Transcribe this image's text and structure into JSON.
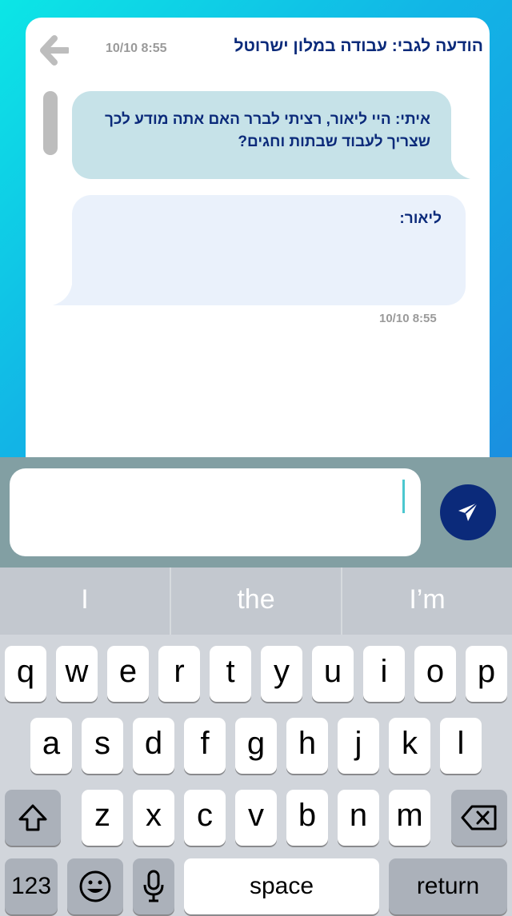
{
  "header": {
    "title": "הודעה לגבי: עבודה במלון ישרוטל",
    "time": "10/10 8:55"
  },
  "messages": [
    {
      "text": "איתי: היי ליאור, רציתי לברר האם אתה מודע לכך שצריך לעבוד שבתות וחגים?"
    },
    {
      "text": "ליאור:",
      "time": "10/10 8:55"
    }
  ],
  "composer": {
    "value": ""
  },
  "keyboard": {
    "suggestions": [
      "I",
      "the",
      "I’m"
    ],
    "row1": [
      "q",
      "w",
      "e",
      "r",
      "t",
      "y",
      "u",
      "i",
      "o",
      "p"
    ],
    "row2": [
      "a",
      "s",
      "d",
      "f",
      "g",
      "h",
      "j",
      "k",
      "l"
    ],
    "row3": [
      "z",
      "x",
      "c",
      "v",
      "b",
      "n",
      "m"
    ],
    "numbers_label": "123",
    "space_label": "space",
    "return_label": "return"
  },
  "icons": {
    "back": "arrow-left-icon",
    "send": "paper-plane-icon",
    "shift": "shift-icon",
    "delete": "backspace-icon",
    "emoji": "emoji-icon",
    "mic": "microphone-icon"
  },
  "colors": {
    "accent": "#0b2a7a",
    "bubble_in": "#c6e2e8",
    "bubble_out": "#eaf1fb"
  }
}
